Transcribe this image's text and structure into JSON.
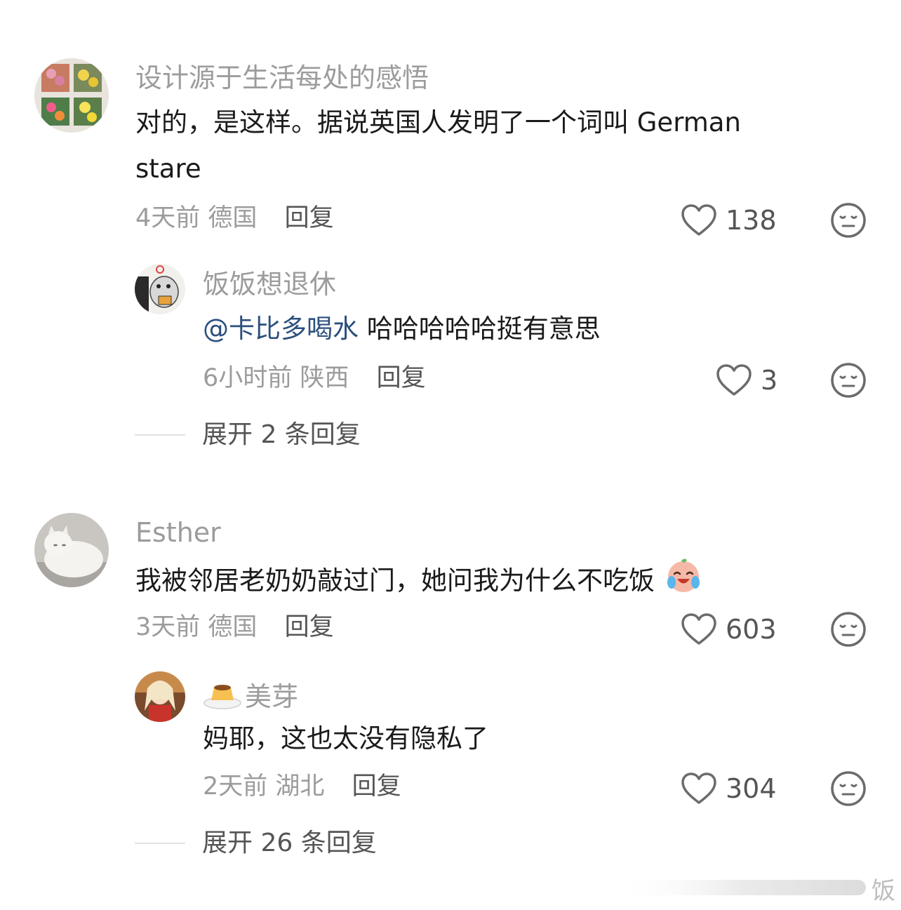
{
  "comments": [
    {
      "username": "设计源于生活每处的感悟",
      "content_line1": "对的，是这样。据说英国人发明了一个词叫 German",
      "content_line2": "stare",
      "time": "4天前",
      "location": "德国",
      "reply_label": "回复",
      "likes": "138",
      "replies": [
        {
          "username": "饭饭想退休",
          "mention": "@卡比多喝水",
          "content": "哈哈哈哈哈挺有意思",
          "time": "6小时前",
          "location": "陕西",
          "reply_label": "回复",
          "likes": "3"
        }
      ],
      "expand_label": "展开 2 条回复"
    },
    {
      "username": "Esther",
      "content": "我被邻居老奶奶敲过门，她问我为什么不吃饭",
      "time": "3天前",
      "location": "德国",
      "reply_label": "回复",
      "likes": "603",
      "replies": [
        {
          "username": "美芽",
          "content": "妈耶，这也太没有隐私了",
          "time": "2天前",
          "location": "湖北",
          "reply_label": "回复",
          "likes": "304"
        }
      ],
      "expand_label": "展开 26 条回复"
    }
  ],
  "watermark": "饭",
  "icons": {
    "like": "heart-outline-icon",
    "reaction": "neutral-face-icon",
    "crying_emoji": "laughing-crying-emoji",
    "pudding": "pudding-emoji"
  },
  "colors": {
    "username": "#9c9c9c",
    "mention": "#2c4f7c",
    "text": "#1a1a1a",
    "meta": "#9c9c9c"
  }
}
